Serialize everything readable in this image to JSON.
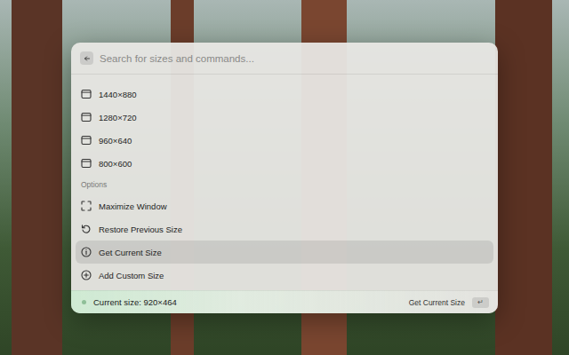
{
  "search": {
    "placeholder": "Search for sizes and commands..."
  },
  "sizes": [
    {
      "label": "1440×880",
      "selected": false
    },
    {
      "label": "1280×720",
      "selected": false
    },
    {
      "label": "960×640",
      "selected": false
    },
    {
      "label": "800×600",
      "selected": false
    }
  ],
  "options_section": {
    "title": "Options"
  },
  "options": [
    {
      "label": "Maximize Window",
      "kind": "maximize",
      "selected": false
    },
    {
      "label": "Restore Previous Size",
      "kind": "restore",
      "selected": false
    },
    {
      "label": "Get Current Size",
      "kind": "info",
      "selected": true
    },
    {
      "label": "Add Custom Size",
      "kind": "add",
      "selected": false
    }
  ],
  "footer": {
    "status": "Current size: 920×464",
    "action": "Get Current Size",
    "key": "↵"
  }
}
